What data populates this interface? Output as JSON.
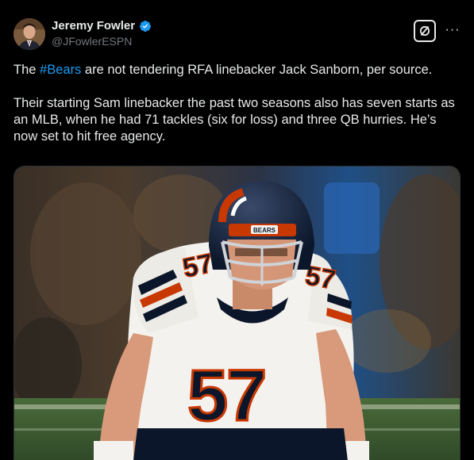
{
  "post": {
    "author": {
      "display_name": "Jeremy Fowler",
      "handle": "@JFowlerESPN",
      "verified": true,
      "avatar_icon": "avatar-photo"
    },
    "text": {
      "line1_prefix": "The ",
      "line1_hashtag": "#Bears",
      "line1_suffix": " are not tendering RFA linebacker Jack Sanborn, per source.",
      "paragraph2": "Their starting Sam linebacker the past two seasons also has seven starts as an MLB, when he had 71 tackles (six for loss) and three QB hurries. He’s now set to hit free agency."
    },
    "actions": {
      "grok_icon": "grok-icon",
      "more_icon": "more-icon",
      "more_label": "···"
    },
    "media": {
      "jersey_number": "57",
      "helmet_text": "BEARS"
    },
    "colors": {
      "background": "#000000",
      "text": "#e7e9ea",
      "secondary_text": "#71767b",
      "link": "#1d9bf0",
      "verified_badge": "#1d9bf0",
      "jersey_number": "#0b162a",
      "accent_orange": "#c83803"
    }
  }
}
